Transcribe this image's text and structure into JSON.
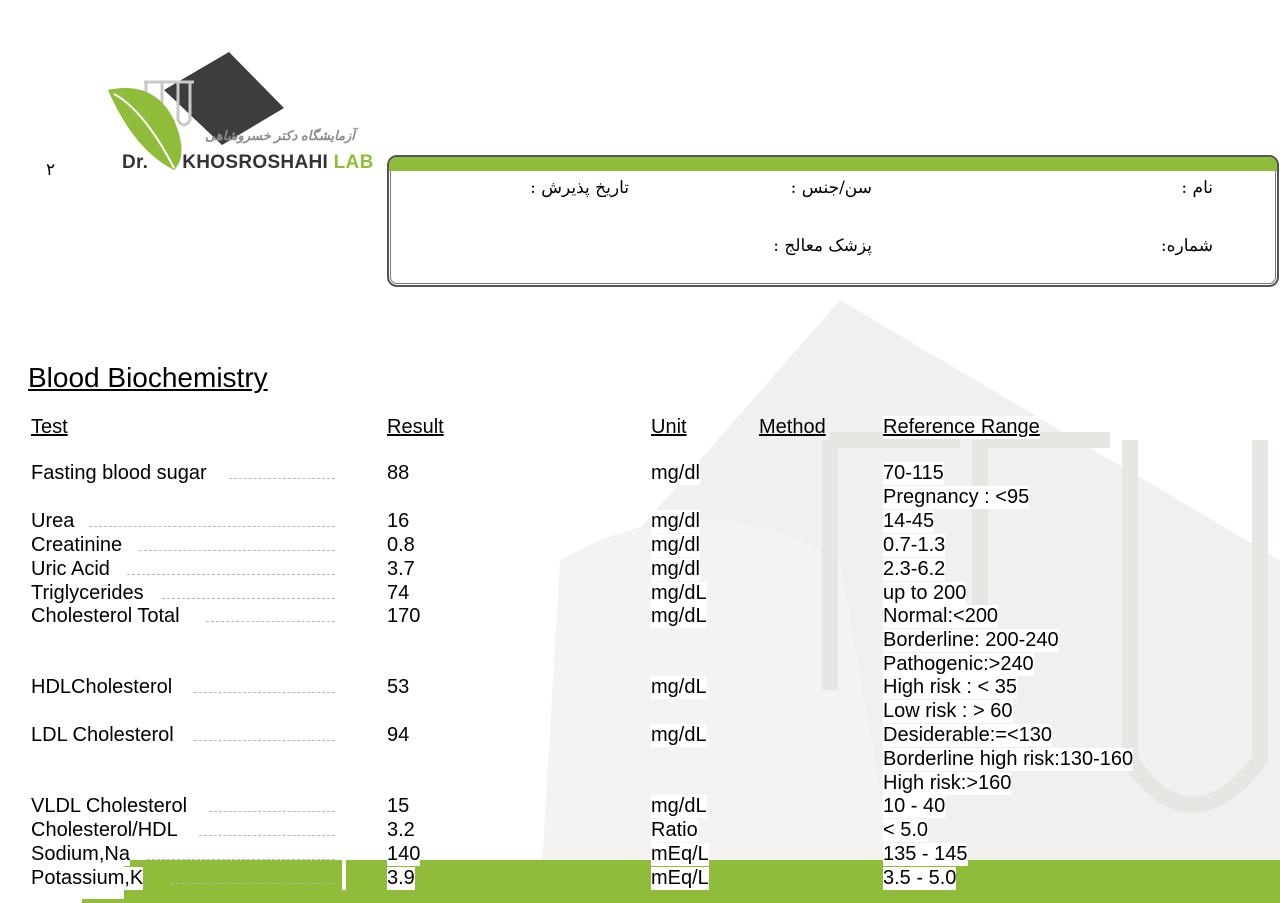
{
  "page_number": "۲",
  "logo": {
    "persian_name": "آزمایشگاه دکتر خسروشاهی",
    "prefix": "Dr.",
    "name": "KHOSROSHAHI",
    "suffix": "LAB",
    "brand_color": "#8fbd3a",
    "dark_color": "#3d3d3d"
  },
  "patient_info": {
    "name_label": "نام :",
    "age_sex_label": "سن/جنس :",
    "admission_date_label": "تاریخ پذیرش :",
    "number_label": "شماره:",
    "physician_label": "پزشک معالج :"
  },
  "section_title": "Blood Biochemistry",
  "table": {
    "headers": {
      "test": "Test",
      "result": "Result",
      "unit": "Unit",
      "method": "Method",
      "reference": "Reference Range"
    },
    "rows": [
      {
        "test": "Fasting blood sugar",
        "result": "88",
        "unit": "mg/dl",
        "method": "",
        "reference": [
          "70-115",
          "Pregnancy : <95"
        ]
      },
      {
        "test": "Urea",
        "result": "16",
        "unit": "mg/dl",
        "method": "",
        "reference": [
          "14-45"
        ]
      },
      {
        "test": "Creatinine",
        "result": "0.8",
        "unit": "mg/dl",
        "method": "",
        "reference": [
          "0.7-1.3"
        ]
      },
      {
        "test": "Uric Acid",
        "result": "3.7",
        "unit": "mg/dl",
        "method": "",
        "reference": [
          "2.3-6.2"
        ]
      },
      {
        "test": "Triglycerides",
        "result": "74",
        "unit": "mg/dL",
        "method": "",
        "reference": [
          "up to 200"
        ]
      },
      {
        "test": "Cholesterol Total",
        "result": "170",
        "unit": "mg/dL",
        "method": "",
        "reference": [
          "Normal:<200",
          "Borderline: 200-240",
          "Pathogenic:>240"
        ]
      },
      {
        "test": "HDLCholesterol",
        "result": "53",
        "unit": "mg/dL",
        "method": "",
        "reference": [
          "High risk : < 35",
          "Low risk : > 60"
        ]
      },
      {
        "test": "LDL Cholesterol",
        "result": "94",
        "unit": "mg/dL",
        "method": "",
        "reference": [
          "Desiderable:=<130",
          "Borderline high risk:130-160",
          "High risk:>160"
        ]
      },
      {
        "test": "VLDL Cholesterol",
        "result": "15",
        "unit": "mg/dL",
        "method": "",
        "reference": [
          "10 - 40"
        ]
      },
      {
        "test": "Cholesterol/HDL",
        "result": "3.2",
        "unit": "Ratio",
        "method": "",
        "reference": [
          "< 5.0"
        ]
      },
      {
        "test": "Sodium,Na",
        "result": "140",
        "unit": "mEq/L",
        "method": "",
        "reference": [
          "135 - 145"
        ]
      },
      {
        "test": "Potassium,K",
        "result": "3.9",
        "unit": "mEq/L",
        "method": "",
        "reference": [
          "3.5 - 5.0"
        ]
      }
    ]
  }
}
